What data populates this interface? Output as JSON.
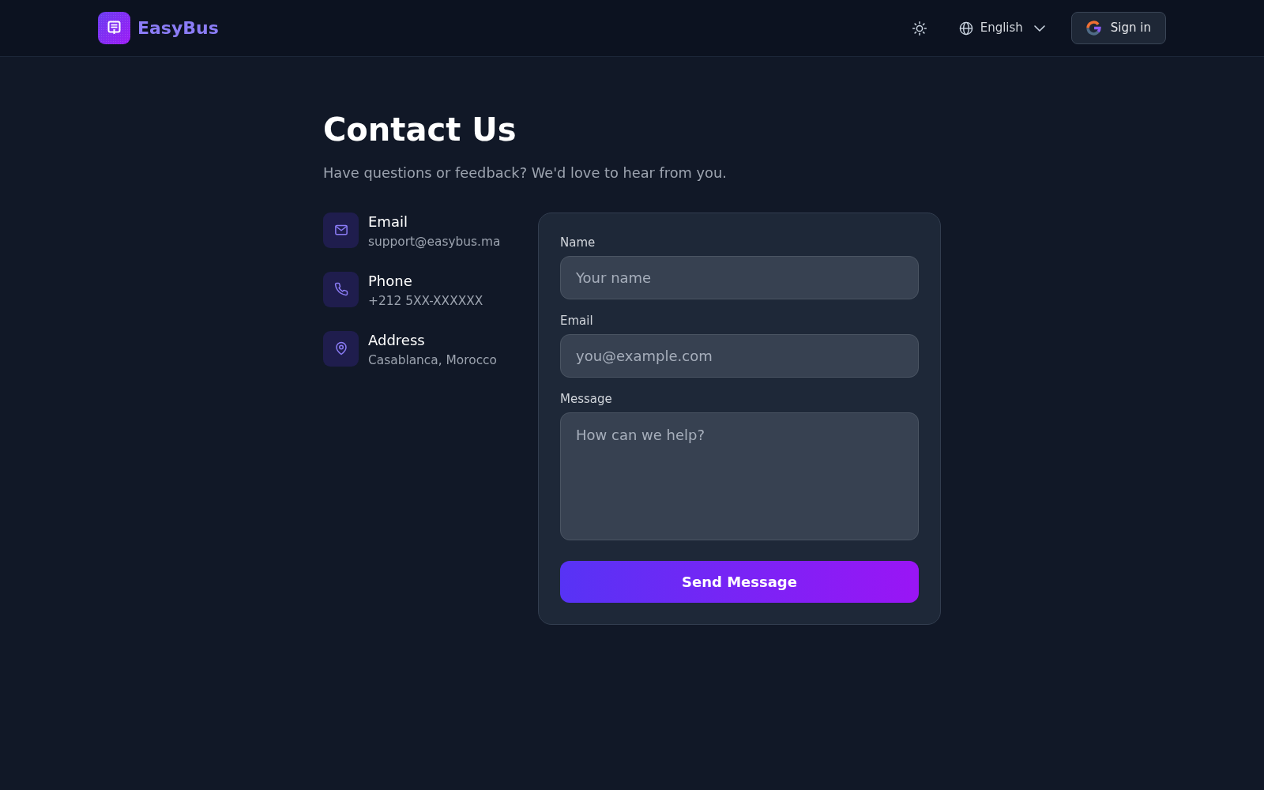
{
  "header": {
    "brand": "EasyBus",
    "language": "English",
    "sign_in": "Sign in"
  },
  "page": {
    "title": "Contact Us",
    "subtitle": "Have questions or feedback? We'd love to hear from you."
  },
  "contacts": [
    {
      "kind": "email",
      "label": "Email",
      "value": "support@easybus.ma"
    },
    {
      "kind": "phone",
      "label": "Phone",
      "value": "+212 5XX-XXXXXX"
    },
    {
      "kind": "address",
      "label": "Address",
      "value": "Casablanca, Morocco"
    }
  ],
  "form": {
    "fields": [
      {
        "kind": "input",
        "label": "Name",
        "placeholder": "Your name"
      },
      {
        "kind": "input",
        "label": "Email",
        "placeholder": "you@example.com"
      },
      {
        "kind": "textarea",
        "label": "Message",
        "placeholder": "How can we help?"
      }
    ],
    "submit": "Send Message"
  }
}
